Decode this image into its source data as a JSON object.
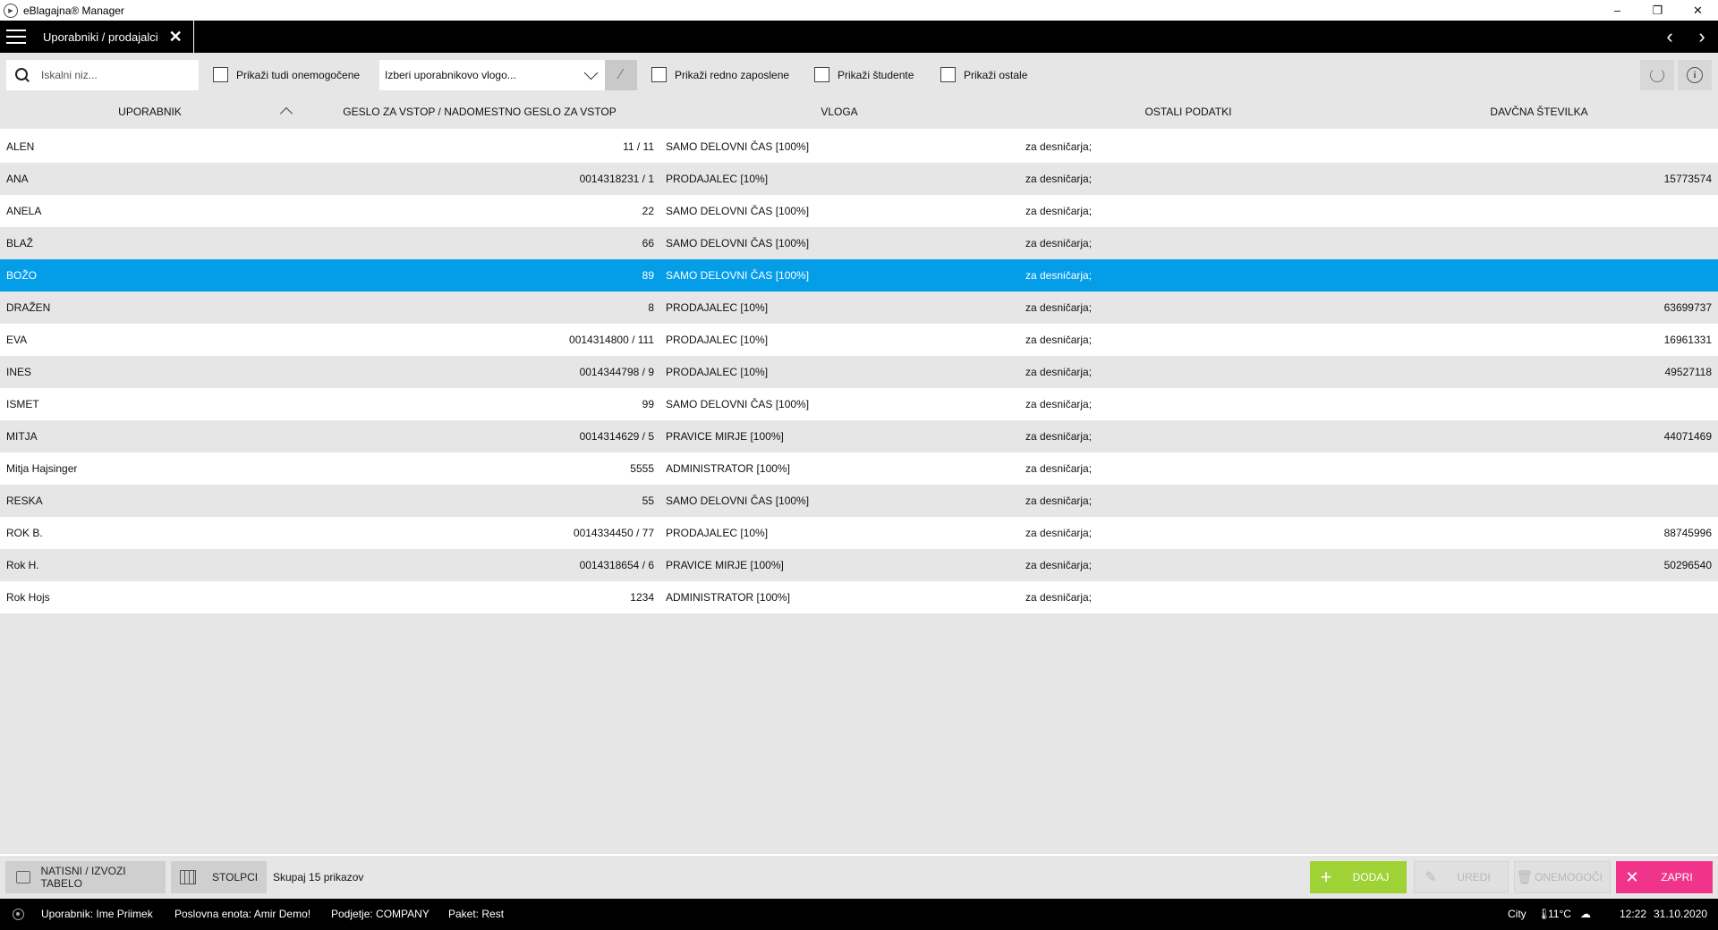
{
  "window": {
    "title": "eBlagajna® Manager",
    "controls": {
      "minimize": "–",
      "restore": "❐",
      "close": "✕"
    }
  },
  "header": {
    "tab_label": "Uporabniki / prodajalci",
    "tab_close": "✕",
    "nav_prev": "‹",
    "nav_next": "›"
  },
  "filters": {
    "search_placeholder": "Iskalni niz...",
    "show_disabled_label": "Prikaži tudi onemogočene",
    "role_select_value": "Izberi uporabnikovo vlogo...",
    "show_regular_label": "Prikaži redno zaposlene",
    "show_students_label": "Prikaži študente",
    "show_other_label": "Prikaži ostale"
  },
  "table": {
    "columns": {
      "user": "UPORABNIK",
      "password": "GESLO ZA VSTOP / NADOMESTNO GESLO ZA VSTOP",
      "role": "VLOGA",
      "other": "OSTALI PODATKI",
      "tax": "DAVČNA ŠTEVILKA"
    },
    "rows": [
      {
        "user": "ALEN",
        "password": "11 / 11",
        "role": "SAMO DELOVNI ČAS [100%]",
        "other": "za desničarja;",
        "tax": ""
      },
      {
        "user": "ANA",
        "password": "0014318231 / 1",
        "role": "PRODAJALEC [10%]",
        "other": "za desničarja;",
        "tax": "15773574"
      },
      {
        "user": "ANELA",
        "password": "22",
        "role": "SAMO DELOVNI ČAS [100%]",
        "other": "za desničarja;",
        "tax": ""
      },
      {
        "user": "BLAŽ",
        "password": "66",
        "role": "SAMO DELOVNI ČAS [100%]",
        "other": "za desničarja;",
        "tax": ""
      },
      {
        "user": "BOŽO",
        "password": "89",
        "role": "SAMO DELOVNI ČAS [100%]",
        "other": "za desničarja;",
        "tax": ""
      },
      {
        "user": "DRAŽEN",
        "password": "8",
        "role": "PRODAJALEC [10%]",
        "other": "za desničarja;",
        "tax": "63699737"
      },
      {
        "user": "EVA",
        "password": "0014314800 / 111",
        "role": "PRODAJALEC [10%]",
        "other": "za desničarja;",
        "tax": "16961331"
      },
      {
        "user": "INES",
        "password": "0014344798 / 9",
        "role": "PRODAJALEC [10%]",
        "other": "za desničarja;",
        "tax": "49527118"
      },
      {
        "user": "ISMET",
        "password": "99",
        "role": "SAMO DELOVNI ČAS [100%]",
        "other": "za desničarja;",
        "tax": ""
      },
      {
        "user": "MITJA",
        "password": "0014314629 / 5",
        "role": "PRAVICE MIRJE [100%]",
        "other": "za desničarja;",
        "tax": "44071469"
      },
      {
        "user": "Mitja Hajsinger",
        "password": "5555",
        "role": "ADMINISTRATOR [100%]",
        "other": "za desničarja;",
        "tax": ""
      },
      {
        "user": "RESKA",
        "password": "55",
        "role": "SAMO DELOVNI ČAS [100%]",
        "other": "za desničarja;",
        "tax": ""
      },
      {
        "user": "ROK B.",
        "password": "0014334450 / 77",
        "role": "PRODAJALEC [10%]",
        "other": "za desničarja;",
        "tax": "88745996"
      },
      {
        "user": "Rok H.",
        "password": "0014318654 / 6",
        "role": "PRAVICE MIRJE [100%]",
        "other": "za desničarja;",
        "tax": "50296540"
      },
      {
        "user": "Rok Hojs",
        "password": "1234",
        "role": "ADMINISTRATOR [100%]",
        "other": "za desničarja;",
        "tax": ""
      }
    ],
    "selected_index": 4
  },
  "actions": {
    "print_label": "NATISNI / IZVOZI TABELO",
    "columns_label": "STOLPCI",
    "count_text": "Skupaj 15 prikazov",
    "add_label": "DODAJ",
    "edit_label": "UREDI",
    "disable_label": "ONEMOGOČI",
    "close_label": "ZAPRI"
  },
  "status": {
    "user": "Uporabnik: Ime Priimek",
    "unit": "Poslovna enota: Amir Demo!",
    "company": "Podjetje: COMPANY",
    "package": "Paket: Rest",
    "city": "City",
    "temperature": "11°C",
    "time": "12:22",
    "date": "31.10.2020"
  },
  "colors": {
    "selected_row": "#049ee8",
    "add_button": "#9ed235",
    "close_button": "#f0348c"
  }
}
